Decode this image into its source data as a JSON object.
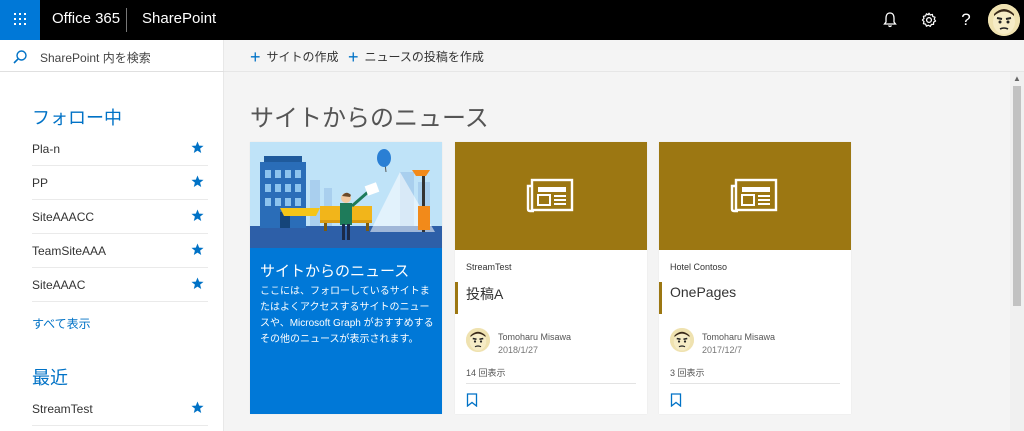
{
  "topbar": {
    "brand": "Office 365",
    "app_name": "SharePoint",
    "icons": [
      "waffle-icon",
      "bell-icon",
      "gear-icon",
      "help-icon",
      "avatar"
    ]
  },
  "leftnav": {
    "search_placeholder": "SharePoint 内を検索",
    "following_title": "フォロー中",
    "following": [
      {
        "label": "Pla-n"
      },
      {
        "label": "PP"
      },
      {
        "label": "SiteAAACC"
      },
      {
        "label": "TeamSiteAAA"
      },
      {
        "label": "SiteAAAC"
      }
    ],
    "see_all": "すべて表示",
    "recent_title": "最近",
    "recent": [
      {
        "label": "StreamTest"
      }
    ]
  },
  "commandbar": {
    "create_site": "サイトの作成",
    "create_news": "ニュースの投稿を作成"
  },
  "main": {
    "title": "サイトからのニュース",
    "hero": {
      "title": "サイトからのニュース",
      "description": "ここには、フォローしているサイトまたはよくアクセスするサイトのニュースや、Microsoft Graph がおすすめするその他のニュースが表示されます。"
    },
    "cards": [
      {
        "site": "StreamTest",
        "title": "投稿A",
        "author": "Tomoharu Misawa",
        "date": "2018/1/27",
        "views": "14 回表示"
      },
      {
        "site": "Hotel Contoso",
        "title": "OnePages",
        "author": "Tomoharu Misawa",
        "date": "2017/12/7",
        "views": "3 回表示"
      }
    ]
  },
  "colors": {
    "accent": "#0078d7",
    "link": "#0072c6",
    "card_thumb": "#9c7712",
    "topbar": "#000000"
  }
}
